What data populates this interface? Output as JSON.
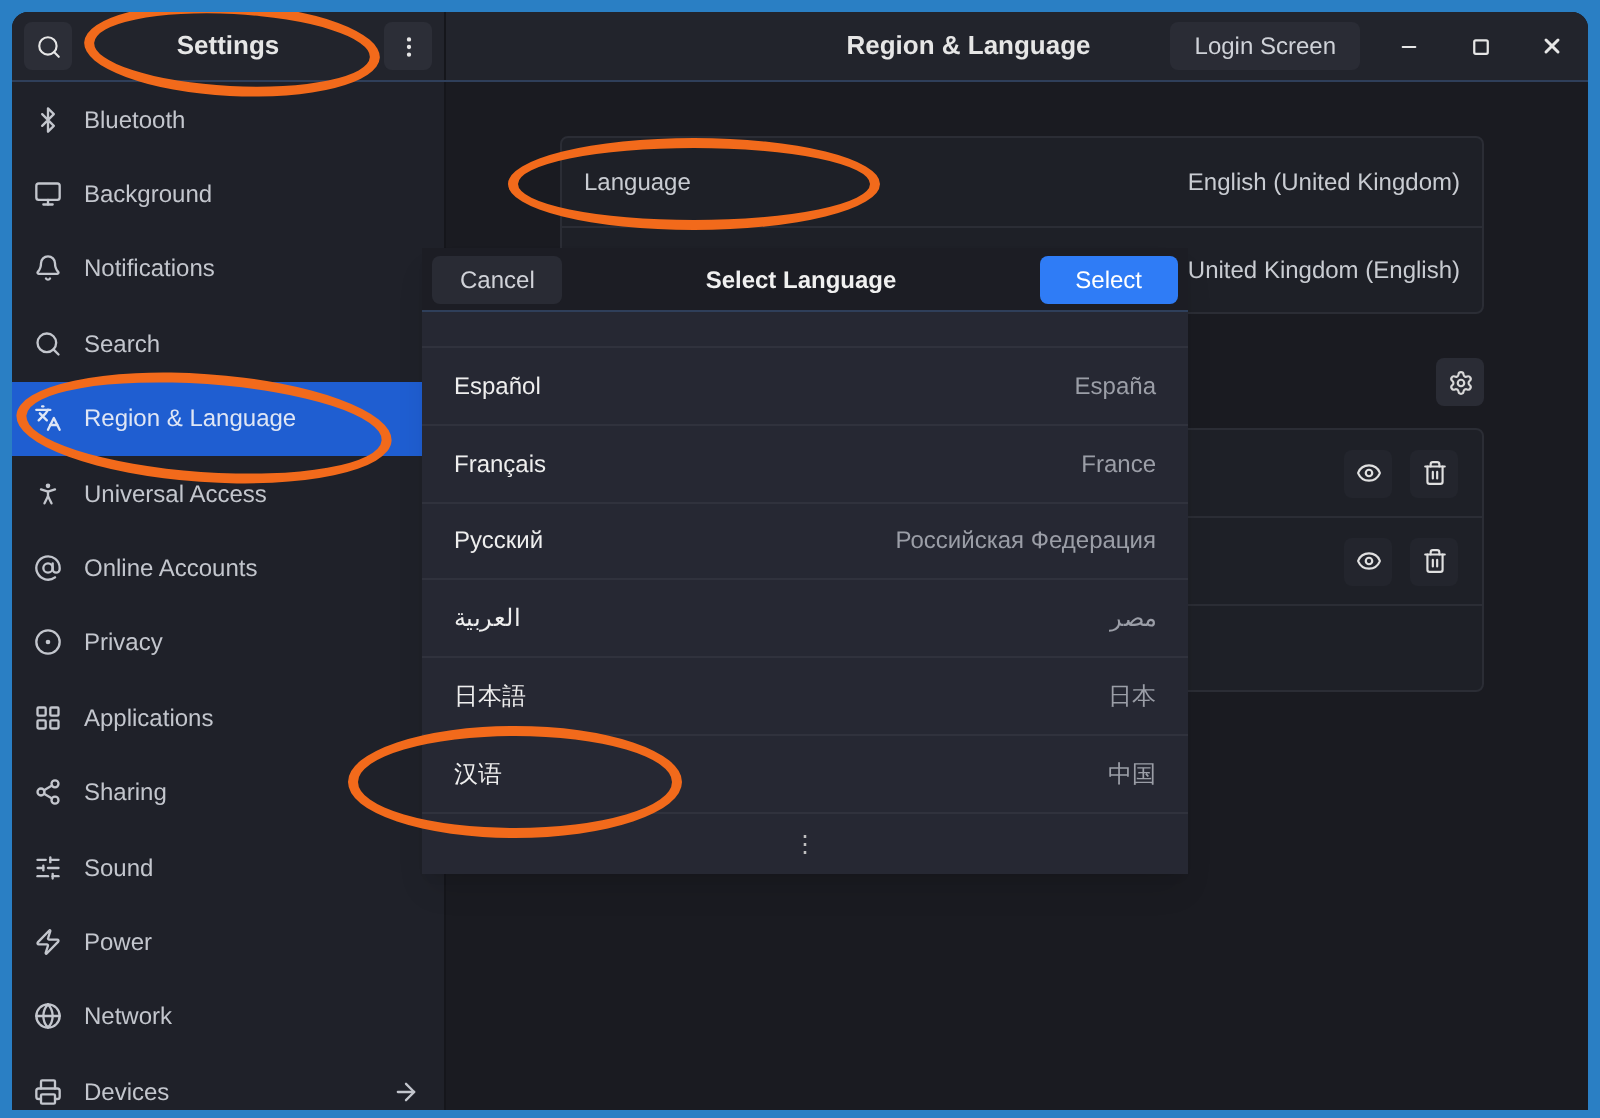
{
  "header": {
    "title": "Settings",
    "panel_title": "Region & Language",
    "login_button": "Login Screen"
  },
  "sidebar": {
    "items": [
      {
        "label": "Bluetooth",
        "selected": false,
        "arrow": false
      },
      {
        "label": "Background",
        "selected": false,
        "arrow": false
      },
      {
        "label": "Notifications",
        "selected": false,
        "arrow": false
      },
      {
        "label": "Search",
        "selected": false,
        "arrow": false
      },
      {
        "label": "Region & Language",
        "selected": true,
        "arrow": false
      },
      {
        "label": "Universal Access",
        "selected": false,
        "arrow": false
      },
      {
        "label": "Online Accounts",
        "selected": false,
        "arrow": false
      },
      {
        "label": "Privacy",
        "selected": false,
        "arrow": false
      },
      {
        "label": "Applications",
        "selected": false,
        "arrow": false
      },
      {
        "label": "Sharing",
        "selected": false,
        "arrow": false
      },
      {
        "label": "Sound",
        "selected": false,
        "arrow": false
      },
      {
        "label": "Power",
        "selected": false,
        "arrow": false
      },
      {
        "label": "Network",
        "selected": false,
        "arrow": false
      },
      {
        "label": "Devices",
        "selected": false,
        "arrow": true
      }
    ]
  },
  "region": {
    "rows": [
      {
        "label": "Language",
        "value": "English (United Kingdom)"
      },
      {
        "value": "United Kingdom (English)"
      }
    ]
  },
  "dialog": {
    "title": "Select Language",
    "cancel": "Cancel",
    "select": "Select",
    "languages": [
      {
        "name": "Español",
        "region": "España"
      },
      {
        "name": "Français",
        "region": "France"
      },
      {
        "name": "Русский",
        "region": "Российская Федерация"
      },
      {
        "name": "العربية",
        "region": "مصر"
      },
      {
        "name": "日本語",
        "region": "日本"
      },
      {
        "name": "汉语",
        "region": "中国"
      }
    ],
    "more": "⋮"
  }
}
